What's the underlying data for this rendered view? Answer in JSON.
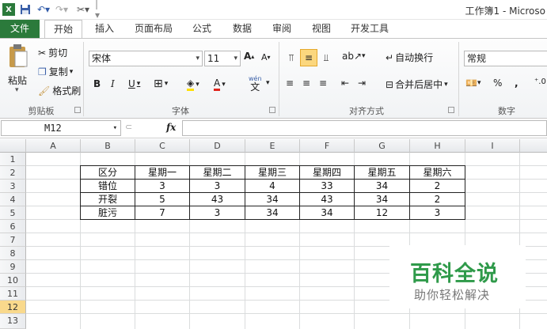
{
  "window": {
    "title": "工作簿1 - Microso"
  },
  "tabs": [
    {
      "label": "文件"
    },
    {
      "label": "开始"
    },
    {
      "label": "插入"
    },
    {
      "label": "页面布局"
    },
    {
      "label": "公式"
    },
    {
      "label": "数据"
    },
    {
      "label": "审阅"
    },
    {
      "label": "视图"
    },
    {
      "label": "开发工具"
    }
  ],
  "ribbon": {
    "clipboard": {
      "paste": "粘贴",
      "cut": "剪切",
      "copy": "复制",
      "format_painter": "格式刷",
      "group": "剪贴板"
    },
    "font": {
      "font_name": "宋体",
      "font_size": "11",
      "group": "字体",
      "bold": "B",
      "italic": "I",
      "underline": "U",
      "grow": "A",
      "shrink": "A",
      "font_color_letter": "A",
      "phonetic": "wén",
      "phonetic_char": "文"
    },
    "alignment": {
      "wrap_text": "自动换行",
      "merge_center": "合并后居中",
      "group": "对齐方式"
    },
    "number": {
      "format": "常规",
      "percent": "%",
      "comma": ",",
      "group": "数字"
    }
  },
  "formula_bar": {
    "name_box": "M12",
    "fx": "fx",
    "value": ""
  },
  "sheet": {
    "columns": [
      "A",
      "B",
      "C",
      "D",
      "E",
      "F",
      "G",
      "H",
      "I"
    ],
    "rows": [
      "1",
      "2",
      "3",
      "4",
      "5",
      "6",
      "7",
      "8",
      "9",
      "10",
      "11",
      "12",
      "13"
    ],
    "selected_row": "12",
    "table": {
      "header": [
        "区分",
        "星期一",
        "星期二",
        "星期三",
        "星期四",
        "星期五",
        "星期六"
      ],
      "rows": [
        [
          "错位",
          "3",
          "3",
          "4",
          "33",
          "34",
          "2"
        ],
        [
          "开裂",
          "5",
          "43",
          "34",
          "43",
          "34",
          "2"
        ],
        [
          "脏污",
          "7",
          "3",
          "34",
          "34",
          "12",
          "3"
        ]
      ]
    }
  },
  "watermark": {
    "title": "百科全说",
    "subtitle": "助你轻松解决"
  },
  "colors": {
    "file_tab": "#2b7a3b",
    "selected_row": "#f9d98c",
    "watermark_green": "#2f9a4a"
  }
}
